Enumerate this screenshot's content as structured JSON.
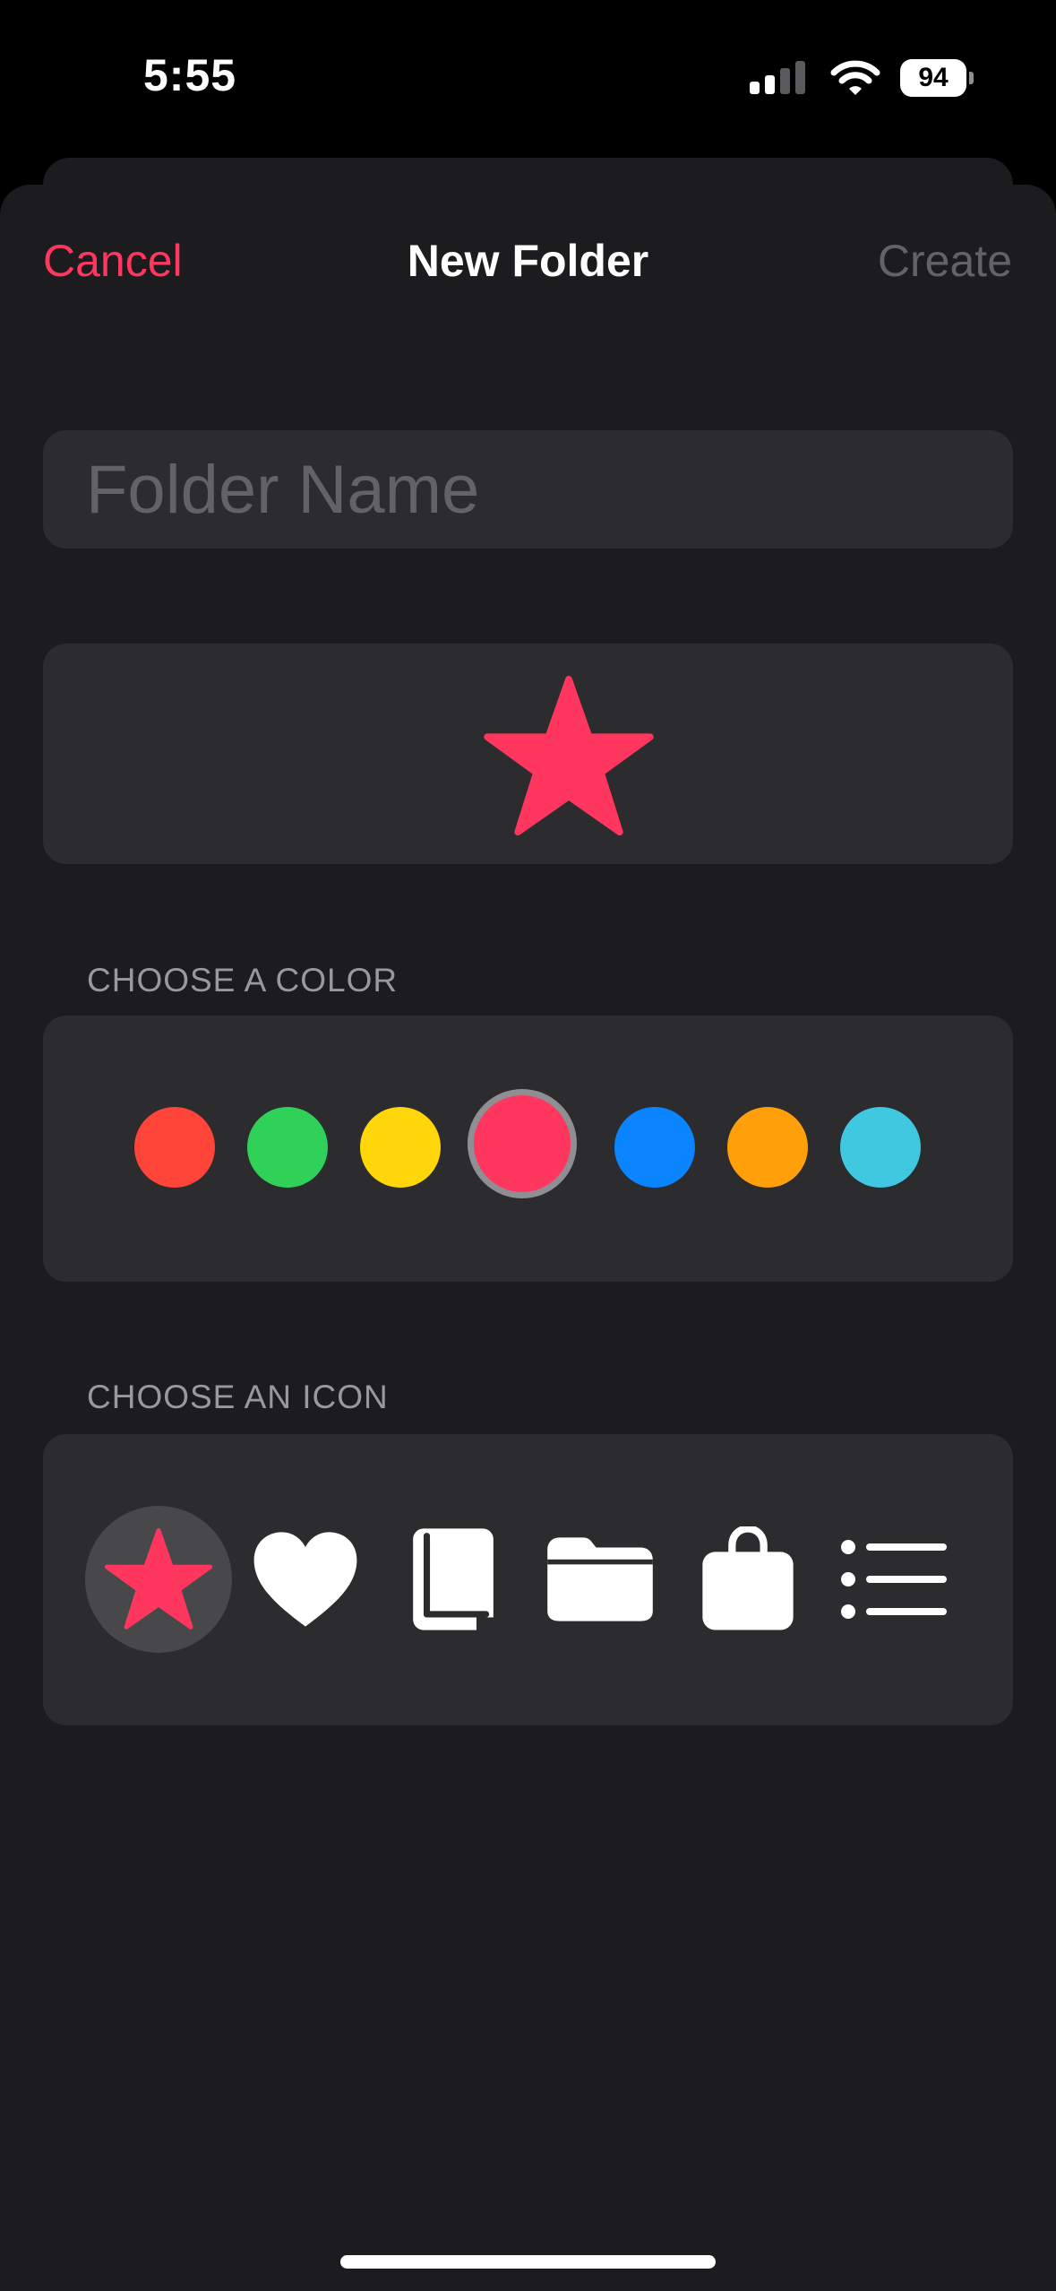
{
  "status_bar": {
    "time": "5:55",
    "battery": "94",
    "signal_icon": "cellular-signal-icon",
    "wifi_icon": "wifi-icon"
  },
  "nav": {
    "cancel_label": "Cancel",
    "title": "New Folder",
    "create_label": "Create"
  },
  "folder_name": {
    "value": "",
    "placeholder": "Folder Name"
  },
  "preview": {
    "icon": "star-icon",
    "color": "#ff375f"
  },
  "colors": {
    "header": "CHOOSE A COLOR",
    "options": [
      "#ff453a",
      "#30d158",
      "#ffd60a",
      "#ff375f",
      "#0a84ff",
      "#ff9f0a",
      "#40c8e0"
    ],
    "selected_index": 3
  },
  "icons": {
    "header": "CHOOSE AN ICON",
    "options": [
      "star-icon",
      "heart-icon",
      "book-icon",
      "folder-icon",
      "bag-icon",
      "list-icon"
    ],
    "selected_index": 0
  },
  "theme": {
    "accent": "#ff375f",
    "background": "#1c1c1e",
    "card": "#2c2c2e",
    "secondary_text": "#98989f",
    "disabled_text": "#636366"
  }
}
